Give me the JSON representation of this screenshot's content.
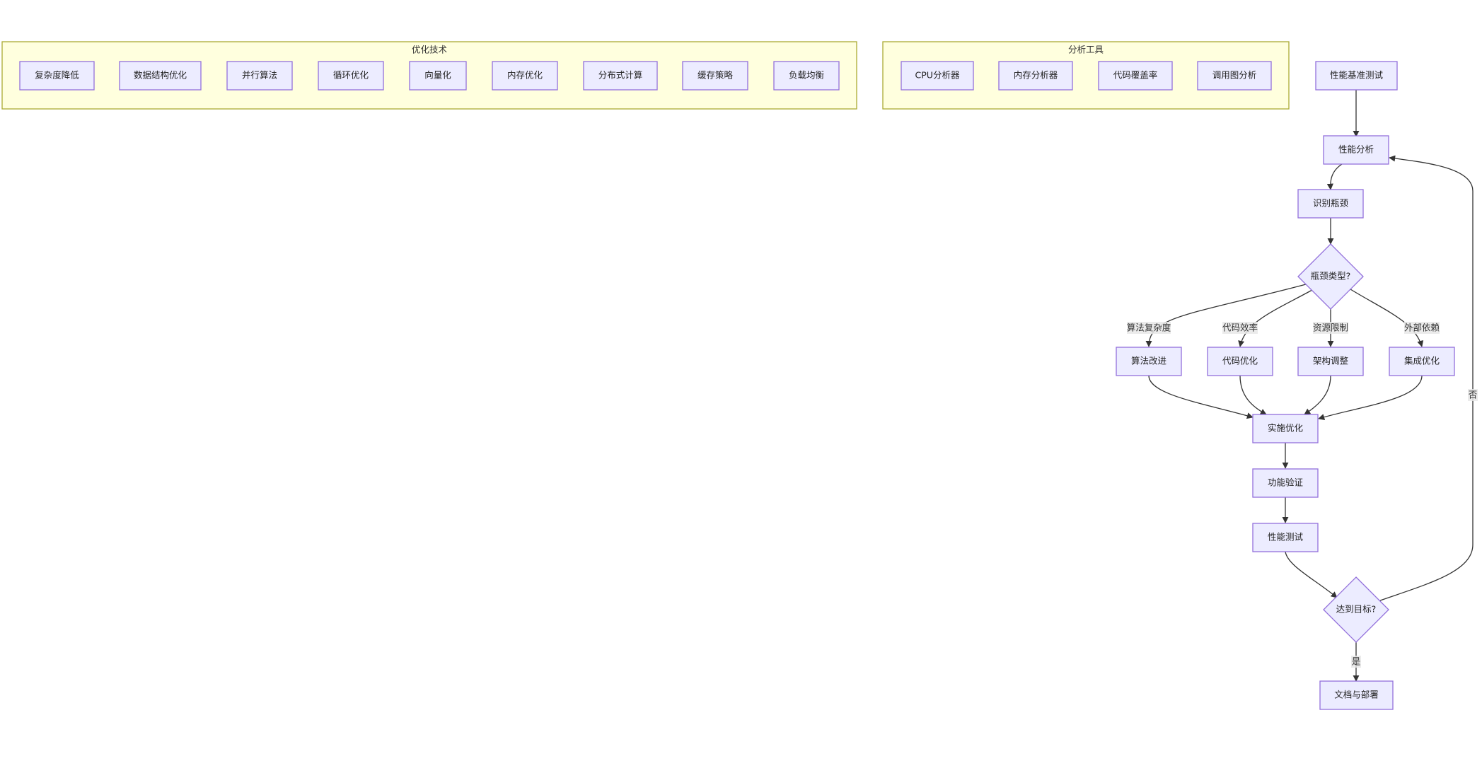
{
  "groups": {
    "optimization": {
      "title": "优化技术",
      "items": [
        "复杂度降低",
        "数据结构优化",
        "并行算法",
        "循环优化",
        "向量化",
        "内存优化",
        "分布式计算",
        "缓存策略",
        "负载均衡"
      ]
    },
    "tools": {
      "title": "分析工具",
      "items": [
        "CPU分析器",
        "内存分析器",
        "代码覆盖率",
        "调用图分析"
      ]
    }
  },
  "flow": {
    "benchmark": "性能基准测试",
    "analysis": "性能分析",
    "identify": "识别瓶颈",
    "decision_type": "瓶颈类型?",
    "algo_improve": "算法改进",
    "code_opt": "代码优化",
    "arch_adjust": "架构调整",
    "integration_opt": "集成优化",
    "implement": "实施优化",
    "func_verify": "功能验证",
    "perf_test": "性能测试",
    "decision_goal": "达到目标?",
    "docs_deploy": "文档与部署"
  },
  "edge_labels": {
    "algo_complexity": "算法复杂度",
    "code_efficiency": "代码效率",
    "resource_limit": "资源限制",
    "external_dep": "外部依赖",
    "yes": "是",
    "no": "否"
  },
  "colors": {
    "node_fill": "#ECECFF",
    "node_stroke": "#9370DB",
    "group_fill": "#FFFFDE",
    "group_stroke": "#AAAA33",
    "edge": "#333333"
  }
}
